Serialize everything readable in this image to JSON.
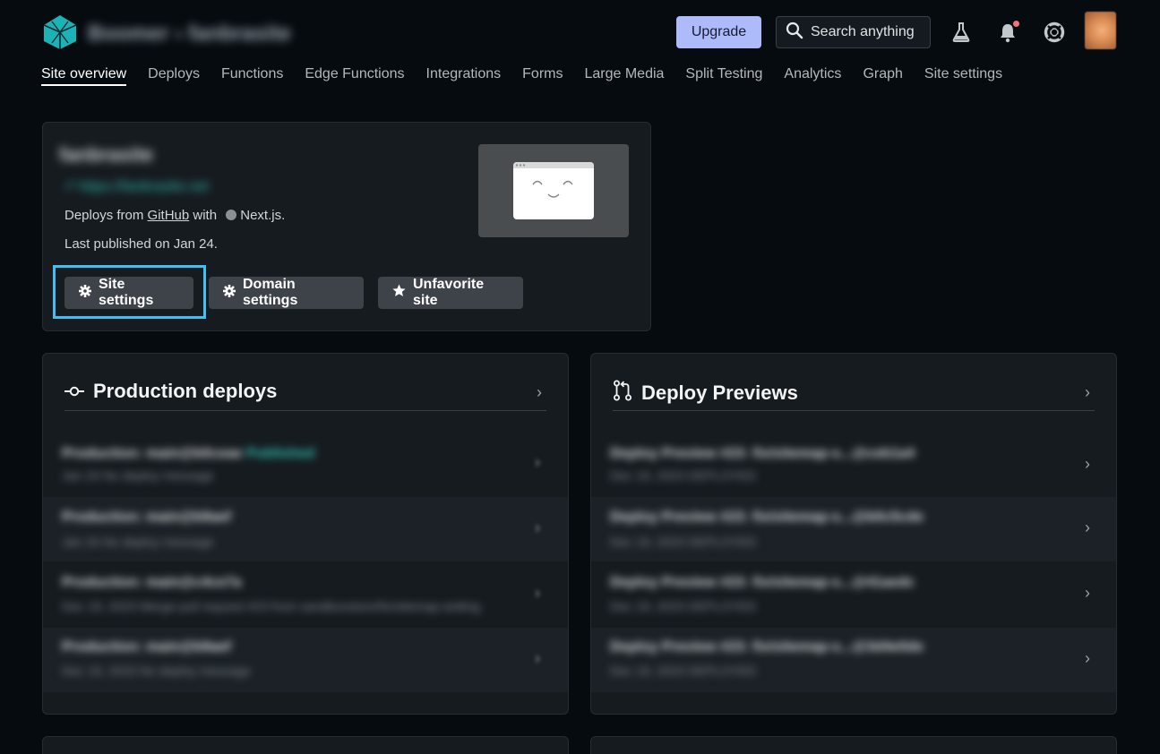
{
  "header": {
    "brand_text": "Boomer › fanbrasite",
    "upgrade_label": "Upgrade",
    "search_label": "Search anything",
    "icons": [
      "flask-icon",
      "bell-icon",
      "help-lifebuoy-icon",
      "avatar"
    ]
  },
  "nav": {
    "items": [
      "Site overview",
      "Deploys",
      "Functions",
      "Edge Functions",
      "Integrations",
      "Forms",
      "Large Media",
      "Split Testing",
      "Analytics",
      "Graph",
      "Site settings"
    ],
    "active_index": 0
  },
  "site": {
    "name": "fanbrasite",
    "url": "↗ https://fanbrasite.net",
    "deploy_prefix": "Deploys from ",
    "deploy_source": "GitHub",
    "deploy_with": " with ",
    "framework": "Next.js.",
    "last_published": "Last published on Jan 24.",
    "buttons": {
      "site_settings": "Site settings",
      "domain_settings": "Domain settings",
      "unfavorite": "Unfavorite site"
    }
  },
  "production": {
    "title": "Production deploys",
    "rows": [
      {
        "title": "Production: main@b0ceae",
        "badge": "Published",
        "sub": "Jan 24 No deploy message"
      },
      {
        "title": "Production: main@b9aef",
        "badge": "",
        "sub": "Jan 24 No deploy message"
      },
      {
        "title": "Production: main@c4ce7a",
        "badge": "",
        "sub": "Dec 19, 2023 Merge pull request #23 from sandboxstore/fix/sitemap-setting"
      },
      {
        "title": "Production: main@b9aef",
        "badge": "",
        "sub": "Dec 19, 2023 No deploy message"
      }
    ]
  },
  "previews": {
    "title": "Deploy Previews",
    "rows": [
      {
        "title": "Deploy Preview #23: fix/sitemap-s...@ceb1a4",
        "sub": "Dec 19, 2023 DEPLOYED"
      },
      {
        "title": "Deploy Preview #23: fix/sitemap-s...@b0c5cde",
        "sub": "Dec 19, 2023 DEPLOYED"
      },
      {
        "title": "Deploy Preview #23: fix/sitemap-s...@41aedc",
        "sub": "Dec 19, 2023 DEPLOYED"
      },
      {
        "title": "Deploy Preview #23: fix/sitemap-s...@3d4e0de",
        "sub": "Dec 19, 2023 DEPLOYED"
      }
    ]
  },
  "colors": {
    "background": "#060b10",
    "accent_upgrade": "#aebbfa",
    "focus_ring": "#3cc0f5",
    "published_badge": "#2fc5b4"
  }
}
